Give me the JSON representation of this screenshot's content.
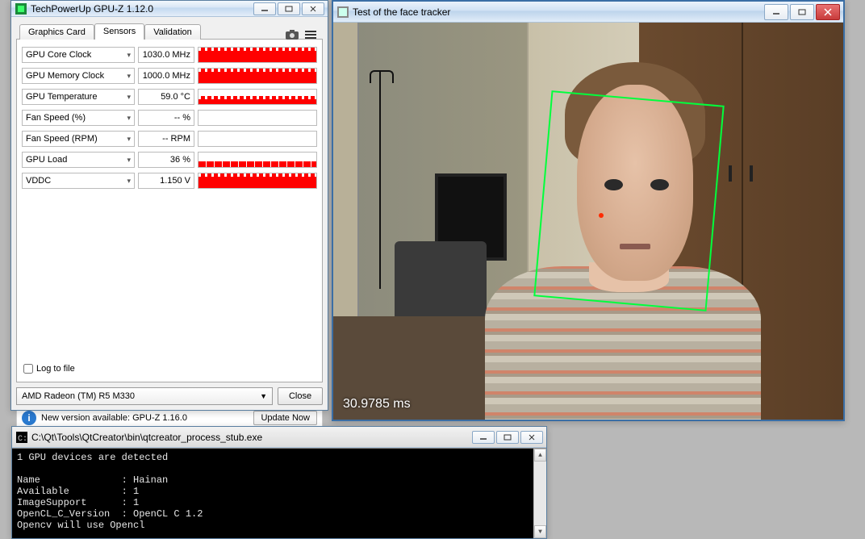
{
  "gpuz": {
    "title": "TechPowerUp GPU-Z 1.12.0",
    "tabs": {
      "graphics": "Graphics Card",
      "sensors": "Sensors",
      "validation": "Validation"
    },
    "sensors": [
      {
        "label": "GPU Core Clock",
        "value": "1030.0 MHz",
        "fill": "full"
      },
      {
        "label": "GPU Memory Clock",
        "value": "1000.0 MHz",
        "fill": "full"
      },
      {
        "label": "GPU Temperature",
        "value": "59.0 °C",
        "fill": "partial"
      },
      {
        "label": "Fan Speed (%)",
        "value": "-- %",
        "fill": "none"
      },
      {
        "label": "Fan Speed (RPM)",
        "value": "-- RPM",
        "fill": "none"
      },
      {
        "label": "GPU Load",
        "value": "36 %",
        "fill": "load"
      },
      {
        "label": "VDDC",
        "value": "1.150 V",
        "fill": "full"
      }
    ],
    "log_to_file": "Log to file",
    "gpu_selected": "AMD Radeon (TM) R5 M330",
    "close": "Close"
  },
  "update": {
    "text": "New version available: GPU-Z 1.16.0",
    "button": "Update Now"
  },
  "facetracker": {
    "title": "Test of the face tracker",
    "timing": "30.9785 ms"
  },
  "console": {
    "title": "C:\\Qt\\Tools\\QtCreator\\bin\\qtcreator_process_stub.exe",
    "lines": "1 GPU devices are detected\n\nName              : Hainan\nAvailable         : 1\nImageSupport      : 1\nOpenCL_C_Version  : OpenCL C 1.2\nOpencv will use Opencl"
  }
}
